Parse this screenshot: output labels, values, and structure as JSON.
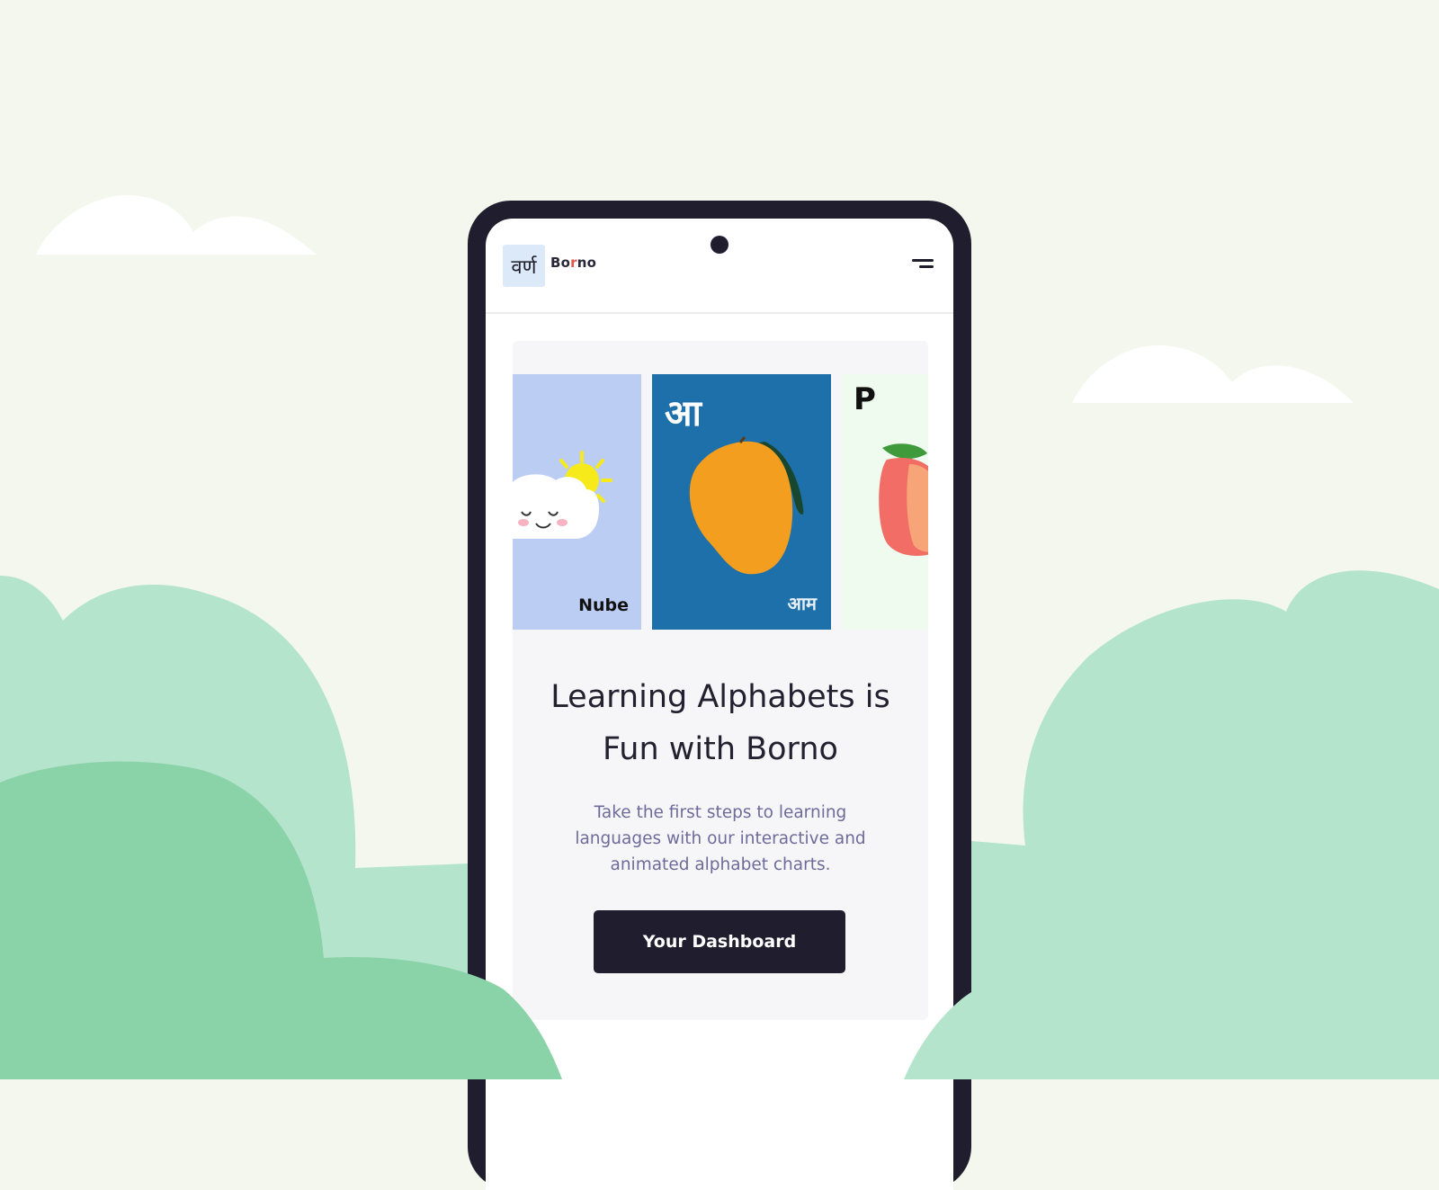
{
  "app": {
    "logo_text": "वर्ण",
    "brand_name_start": "Bo",
    "brand_name_accent": "r",
    "brand_name_end": "no"
  },
  "header": {
    "menu_icon": "hamburger-menu-icon"
  },
  "carousel": {
    "cards": [
      {
        "word": "Nube",
        "letter": "",
        "icon": "cloud-sun-icon",
        "color": "#bccdf4"
      },
      {
        "letter": "आ",
        "word": "आम",
        "icon": "mango-icon",
        "color": "#1d70a9"
      },
      {
        "letter": "P",
        "word": "",
        "icon": "peach-icon",
        "color": "#eefbee"
      }
    ]
  },
  "hero": {
    "title_line1": "Learning Alphabets is",
    "title_line2": "Fun with Borno",
    "subtitle_line1": "Take the first steps to learning",
    "subtitle_line2": "languages with our interactive and",
    "subtitle_line3": "animated alphabet charts.",
    "cta_label": "Your Dashboard"
  },
  "colors": {
    "background": "#f4f7ee",
    "phone_frame": "#201e2e",
    "cta": "#201e2e",
    "subtitle": "#6e6b9b",
    "brand_accent": "#e0564a",
    "hill_light": "#b4e4cc",
    "hill_dark": "#8ad2a8"
  }
}
